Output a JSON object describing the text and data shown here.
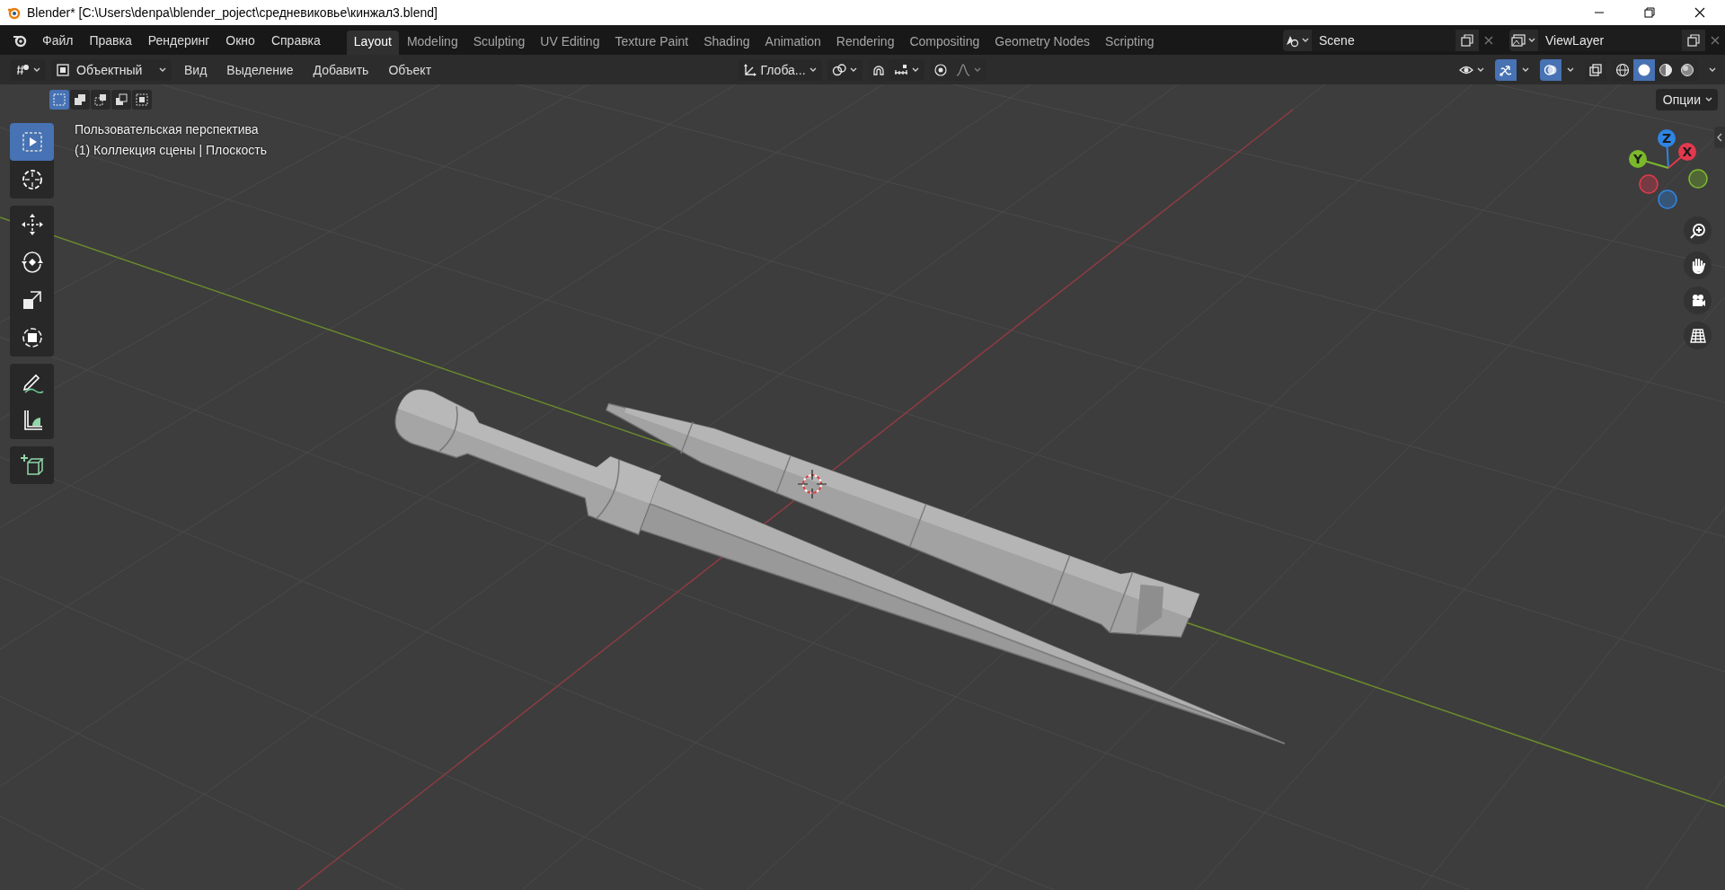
{
  "window": {
    "title": "Blender* [C:\\Users\\denpa\\blender_poject\\средневиковье\\кинжал3.blend]"
  },
  "menu": [
    "Файл",
    "Правка",
    "Рендеринг",
    "Окно",
    "Справка"
  ],
  "workspaces": [
    {
      "label": "Layout",
      "selected": true
    },
    {
      "label": "Modeling",
      "selected": false
    },
    {
      "label": "Sculpting",
      "selected": false
    },
    {
      "label": "UV Editing",
      "selected": false
    },
    {
      "label": "Texture Paint",
      "selected": false
    },
    {
      "label": "Shading",
      "selected": false
    },
    {
      "label": "Animation",
      "selected": false
    },
    {
      "label": "Rendering",
      "selected": false
    },
    {
      "label": "Compositing",
      "selected": false
    },
    {
      "label": "Geometry Nodes",
      "selected": false
    },
    {
      "label": "Scripting",
      "selected": false
    }
  ],
  "scene": {
    "value": "Scene"
  },
  "view_layer": {
    "value": "ViewLayer"
  },
  "header": {
    "mode": "Объектный",
    "menus": [
      "Вид",
      "Выделение",
      "Добавить",
      "Объект"
    ],
    "orientation": "Глоба...",
    "options": "Опции"
  },
  "snapping": {
    "on": false
  },
  "proportional_editing": {
    "on": false
  },
  "gizmos": {
    "on": true
  },
  "overlays": {
    "on": true
  },
  "xray": {
    "on": false
  },
  "shading": [
    {
      "kind": "wireframe",
      "selected": false
    },
    {
      "kind": "solid",
      "selected": true
    },
    {
      "kind": "material",
      "selected": false
    },
    {
      "kind": "rendered",
      "selected": false
    }
  ],
  "select_modes": [
    {
      "kind": "set",
      "selected": true
    },
    {
      "kind": "extend",
      "selected": false
    },
    {
      "kind": "subtract",
      "selected": false
    },
    {
      "kind": "invert",
      "selected": false
    },
    {
      "kind": "intersect",
      "selected": false
    }
  ],
  "tools": [
    {
      "kind": "select_box",
      "selected": true
    },
    {
      "kind": "cursor",
      "selected": false
    },
    {
      "kind": "move",
      "selected": false
    },
    {
      "kind": "rotate",
      "selected": false
    },
    {
      "kind": "scale",
      "selected": false
    },
    {
      "kind": "transform",
      "selected": false
    },
    {
      "kind": "annotate",
      "selected": false
    },
    {
      "kind": "measure",
      "selected": false
    },
    {
      "kind": "add_cube",
      "selected": false
    }
  ],
  "viewport": {
    "view_name": "Пользовательская перспектива",
    "collection": "(1) Коллекция сцены | Плоскость"
  },
  "axes": [
    {
      "label": "Z",
      "color": "#2f85e3"
    },
    {
      "label": "X",
      "color": "#e2394e"
    },
    {
      "label": "Y",
      "color": "#7bb82c"
    }
  ]
}
